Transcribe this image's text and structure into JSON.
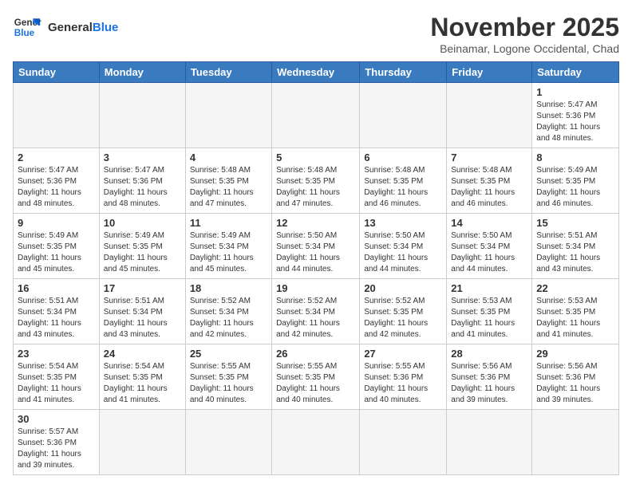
{
  "header": {
    "logo_general": "General",
    "logo_blue": "Blue",
    "month_title": "November 2025",
    "subtitle": "Beinamar, Logone Occidental, Chad"
  },
  "weekdays": [
    "Sunday",
    "Monday",
    "Tuesday",
    "Wednesday",
    "Thursday",
    "Friday",
    "Saturday"
  ],
  "weeks": [
    [
      {
        "day": "",
        "info": ""
      },
      {
        "day": "",
        "info": ""
      },
      {
        "day": "",
        "info": ""
      },
      {
        "day": "",
        "info": ""
      },
      {
        "day": "",
        "info": ""
      },
      {
        "day": "",
        "info": ""
      },
      {
        "day": "1",
        "info": "Sunrise: 5:47 AM\nSunset: 5:36 PM\nDaylight: 11 hours and 48 minutes."
      }
    ],
    [
      {
        "day": "2",
        "info": "Sunrise: 5:47 AM\nSunset: 5:36 PM\nDaylight: 11 hours and 48 minutes."
      },
      {
        "day": "3",
        "info": "Sunrise: 5:47 AM\nSunset: 5:36 PM\nDaylight: 11 hours and 48 minutes."
      },
      {
        "day": "4",
        "info": "Sunrise: 5:48 AM\nSunset: 5:35 PM\nDaylight: 11 hours and 47 minutes."
      },
      {
        "day": "5",
        "info": "Sunrise: 5:48 AM\nSunset: 5:35 PM\nDaylight: 11 hours and 47 minutes."
      },
      {
        "day": "6",
        "info": "Sunrise: 5:48 AM\nSunset: 5:35 PM\nDaylight: 11 hours and 46 minutes."
      },
      {
        "day": "7",
        "info": "Sunrise: 5:48 AM\nSunset: 5:35 PM\nDaylight: 11 hours and 46 minutes."
      },
      {
        "day": "8",
        "info": "Sunrise: 5:49 AM\nSunset: 5:35 PM\nDaylight: 11 hours and 46 minutes."
      }
    ],
    [
      {
        "day": "9",
        "info": "Sunrise: 5:49 AM\nSunset: 5:35 PM\nDaylight: 11 hours and 45 minutes."
      },
      {
        "day": "10",
        "info": "Sunrise: 5:49 AM\nSunset: 5:35 PM\nDaylight: 11 hours and 45 minutes."
      },
      {
        "day": "11",
        "info": "Sunrise: 5:49 AM\nSunset: 5:34 PM\nDaylight: 11 hours and 45 minutes."
      },
      {
        "day": "12",
        "info": "Sunrise: 5:50 AM\nSunset: 5:34 PM\nDaylight: 11 hours and 44 minutes."
      },
      {
        "day": "13",
        "info": "Sunrise: 5:50 AM\nSunset: 5:34 PM\nDaylight: 11 hours and 44 minutes."
      },
      {
        "day": "14",
        "info": "Sunrise: 5:50 AM\nSunset: 5:34 PM\nDaylight: 11 hours and 44 minutes."
      },
      {
        "day": "15",
        "info": "Sunrise: 5:51 AM\nSunset: 5:34 PM\nDaylight: 11 hours and 43 minutes."
      }
    ],
    [
      {
        "day": "16",
        "info": "Sunrise: 5:51 AM\nSunset: 5:34 PM\nDaylight: 11 hours and 43 minutes."
      },
      {
        "day": "17",
        "info": "Sunrise: 5:51 AM\nSunset: 5:34 PM\nDaylight: 11 hours and 43 minutes."
      },
      {
        "day": "18",
        "info": "Sunrise: 5:52 AM\nSunset: 5:34 PM\nDaylight: 11 hours and 42 minutes."
      },
      {
        "day": "19",
        "info": "Sunrise: 5:52 AM\nSunset: 5:34 PM\nDaylight: 11 hours and 42 minutes."
      },
      {
        "day": "20",
        "info": "Sunrise: 5:52 AM\nSunset: 5:35 PM\nDaylight: 11 hours and 42 minutes."
      },
      {
        "day": "21",
        "info": "Sunrise: 5:53 AM\nSunset: 5:35 PM\nDaylight: 11 hours and 41 minutes."
      },
      {
        "day": "22",
        "info": "Sunrise: 5:53 AM\nSunset: 5:35 PM\nDaylight: 11 hours and 41 minutes."
      }
    ],
    [
      {
        "day": "23",
        "info": "Sunrise: 5:54 AM\nSunset: 5:35 PM\nDaylight: 11 hours and 41 minutes."
      },
      {
        "day": "24",
        "info": "Sunrise: 5:54 AM\nSunset: 5:35 PM\nDaylight: 11 hours and 41 minutes."
      },
      {
        "day": "25",
        "info": "Sunrise: 5:55 AM\nSunset: 5:35 PM\nDaylight: 11 hours and 40 minutes."
      },
      {
        "day": "26",
        "info": "Sunrise: 5:55 AM\nSunset: 5:35 PM\nDaylight: 11 hours and 40 minutes."
      },
      {
        "day": "27",
        "info": "Sunrise: 5:55 AM\nSunset: 5:36 PM\nDaylight: 11 hours and 40 minutes."
      },
      {
        "day": "28",
        "info": "Sunrise: 5:56 AM\nSunset: 5:36 PM\nDaylight: 11 hours and 39 minutes."
      },
      {
        "day": "29",
        "info": "Sunrise: 5:56 AM\nSunset: 5:36 PM\nDaylight: 11 hours and 39 minutes."
      }
    ],
    [
      {
        "day": "30",
        "info": "Sunrise: 5:57 AM\nSunset: 5:36 PM\nDaylight: 11 hours and 39 minutes."
      },
      {
        "day": "",
        "info": ""
      },
      {
        "day": "",
        "info": ""
      },
      {
        "day": "",
        "info": ""
      },
      {
        "day": "",
        "info": ""
      },
      {
        "day": "",
        "info": ""
      },
      {
        "day": "",
        "info": ""
      }
    ]
  ]
}
